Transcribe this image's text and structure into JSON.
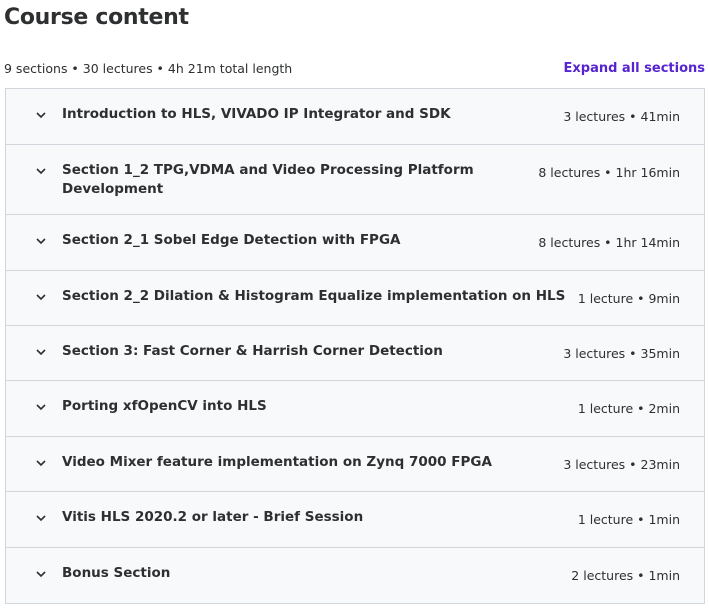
{
  "header": {
    "title": "Course content",
    "summary": "9 sections • 30 lectures • 4h 21m total length",
    "expand_all_label": "Expand all sections"
  },
  "sections": [
    {
      "title": "Introduction to HLS, VIVADO IP Integrator and SDK",
      "meta": "3 lectures • 41min"
    },
    {
      "title": "Section 1_2 TPG,VDMA and Video Processing Platform Development",
      "meta": "8 lectures • 1hr 16min"
    },
    {
      "title": "Section 2_1 Sobel Edge Detection with FPGA",
      "meta": "8 lectures • 1hr 14min"
    },
    {
      "title": "Section 2_2 Dilation & Histogram Equalize implementation on HLS",
      "meta": "1 lecture • 9min"
    },
    {
      "title": "Section 3: Fast Corner & Harrish Corner Detection",
      "meta": "3 lectures • 35min"
    },
    {
      "title": "Porting xfOpenCV into HLS",
      "meta": "1 lecture • 2min"
    },
    {
      "title": "Video Mixer feature implementation on Zynq 7000 FPGA",
      "meta": "3 lectures • 23min"
    },
    {
      "title": "Vitis HLS 2020.2 or later - Brief Session",
      "meta": "1 lecture • 1min"
    },
    {
      "title": "Bonus Section",
      "meta": "2 lectures • 1min"
    }
  ],
  "icons": {
    "section_toggle": "chevron-down-icon"
  },
  "colors": {
    "accent": "#5624d0",
    "text": "#2d2f31",
    "section_bg": "#f7f9fa",
    "border": "#d1d7dc"
  }
}
